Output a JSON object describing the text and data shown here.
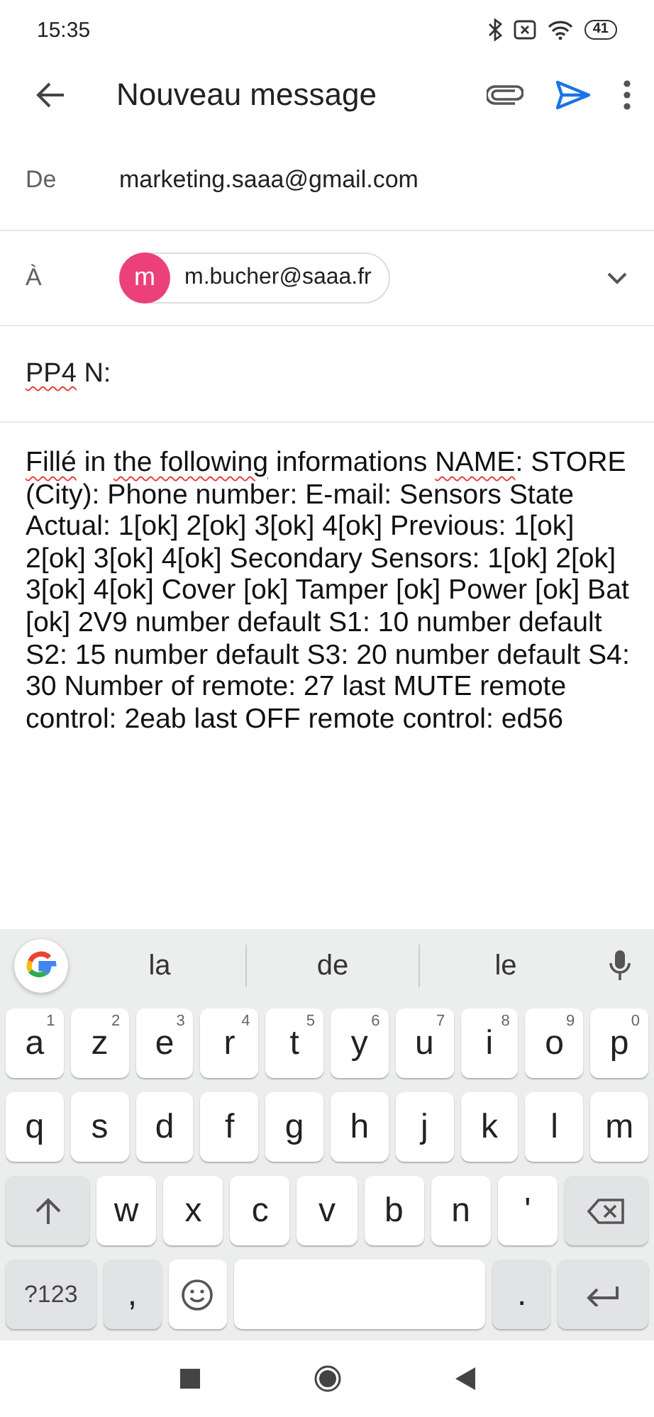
{
  "status_bar": {
    "time": "15:35",
    "battery": "41"
  },
  "toolbar": {
    "title": "Nouveau message"
  },
  "from": {
    "label": "De",
    "value": "marketing.saaa@gmail.com"
  },
  "to": {
    "label": "À",
    "chips": [
      {
        "initial": "m",
        "address": "m.bucher@saaa.fr",
        "color": "#ec407a"
      }
    ]
  },
  "subject": {
    "segments": [
      {
        "text": "PP4",
        "misspelled": true
      },
      {
        "text": " N:",
        "misspelled": false
      }
    ]
  },
  "body": {
    "segments": [
      {
        "text": "Fillé",
        "misspelled": true
      },
      {
        "text": " in ",
        "misspelled": false
      },
      {
        "text": "the following",
        "misspelled": true
      },
      {
        "text": " informations ",
        "misspelled": false
      },
      {
        "text": "NAME",
        "misspelled": true
      },
      {
        "text": ": STORE (City): Phone number: E-mail: Sensors State Actual: 1[ok] 2[ok] 3[ok] 4[ok] Previous: 1[ok] 2[ok] 3[ok] 4[ok] Secondary Sensors: 1[ok] 2[ok] 3[ok] 4[ok] Cover [ok] Tamper [ok] Power [ok] Bat [ok] 2V9 number default S1: 10 number default S2: 15 number default S3: 20 number default S4: 30 Number of remote: 27 last MUTE remote control: 2eab last OFF remote control: ed56",
        "misspelled": false
      }
    ]
  },
  "keyboard": {
    "suggestions": [
      "la",
      "de",
      "le"
    ],
    "rows": [
      [
        {
          "kind": "letter",
          "label": "a",
          "hint": "1"
        },
        {
          "kind": "letter",
          "label": "z",
          "hint": "2"
        },
        {
          "kind": "letter",
          "label": "e",
          "hint": "3"
        },
        {
          "kind": "letter",
          "label": "r",
          "hint": "4"
        },
        {
          "kind": "letter",
          "label": "t",
          "hint": "5"
        },
        {
          "kind": "letter",
          "label": "y",
          "hint": "6"
        },
        {
          "kind": "letter",
          "label": "u",
          "hint": "7"
        },
        {
          "kind": "letter",
          "label": "i",
          "hint": "8"
        },
        {
          "kind": "letter",
          "label": "o",
          "hint": "9"
        },
        {
          "kind": "letter",
          "label": "p",
          "hint": "0"
        }
      ],
      [
        {
          "kind": "letter",
          "label": "q"
        },
        {
          "kind": "letter",
          "label": "s"
        },
        {
          "kind": "letter",
          "label": "d"
        },
        {
          "kind": "letter",
          "label": "f"
        },
        {
          "kind": "letter",
          "label": "g"
        },
        {
          "kind": "letter",
          "label": "h"
        },
        {
          "kind": "letter",
          "label": "j"
        },
        {
          "kind": "letter",
          "label": "k"
        },
        {
          "kind": "letter",
          "label": "l"
        },
        {
          "kind": "letter",
          "label": "m"
        }
      ],
      [
        {
          "kind": "shift"
        },
        {
          "kind": "letter",
          "label": "w"
        },
        {
          "kind": "letter",
          "label": "x"
        },
        {
          "kind": "letter",
          "label": "c"
        },
        {
          "kind": "letter",
          "label": "v"
        },
        {
          "kind": "letter",
          "label": "b"
        },
        {
          "kind": "letter",
          "label": "n"
        },
        {
          "kind": "letter",
          "label": "'"
        },
        {
          "kind": "backspace"
        }
      ],
      [
        {
          "kind": "symbols",
          "label": "?123"
        },
        {
          "kind": "punct",
          "label": ","
        },
        {
          "kind": "emoji"
        },
        {
          "kind": "space"
        },
        {
          "kind": "punct",
          "label": "."
        },
        {
          "kind": "enter"
        }
      ]
    ]
  }
}
